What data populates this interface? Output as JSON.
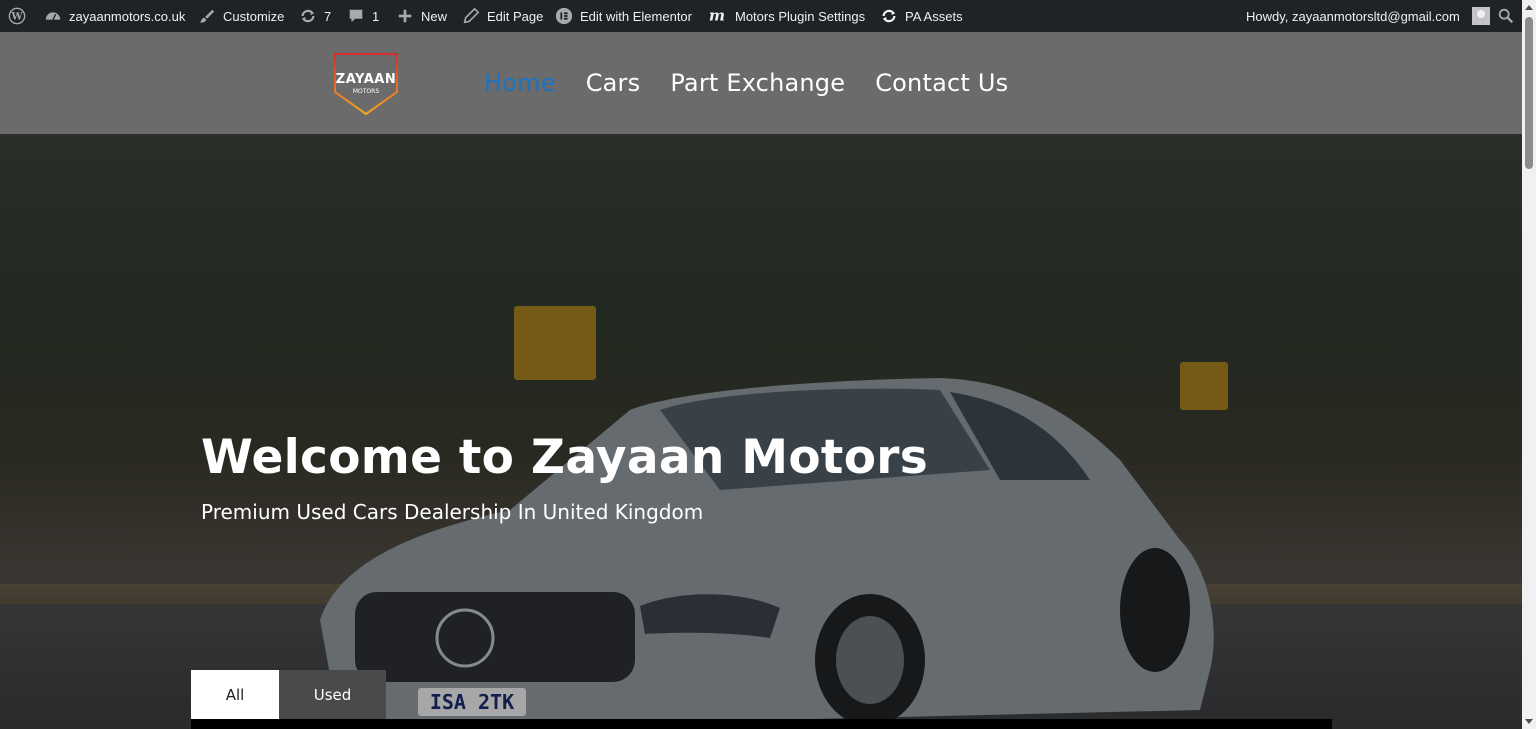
{
  "admin_bar": {
    "site_name": "zayaanmotors.co.uk",
    "customize": "Customize",
    "updates_count": "7",
    "comments_count": "1",
    "new": "New",
    "edit_page": "Edit Page",
    "edit_elementor": "Edit with Elementor",
    "motors_settings": "Motors Plugin Settings",
    "pa_assets": "PA Assets",
    "howdy": "Howdy, zayaanmotorsltd@gmail.com"
  },
  "header": {
    "logo_text": "ZAYAAN",
    "logo_subtext": "MOTORS",
    "nav": [
      {
        "label": "Home",
        "active": true
      },
      {
        "label": "Cars",
        "active": false
      },
      {
        "label": "Part Exchange",
        "active": false
      },
      {
        "label": "Contact Us",
        "active": false
      }
    ],
    "active_color": "#1e73be"
  },
  "hero": {
    "title": "Welcome to Zayaan Motors",
    "subtitle": "Premium Used Cars Dealership In United Kingdom",
    "tabs": [
      {
        "label": "All",
        "selected": true
      },
      {
        "label": "Used",
        "selected": false
      }
    ],
    "car_plate": "ISA 2TK"
  },
  "icons": [
    "wordpress-icon",
    "dashboard-icon",
    "brush-icon",
    "updates-icon",
    "comment-icon",
    "plus-icon",
    "pencil-icon",
    "elementor-icon",
    "motors-icon",
    "refresh-icon",
    "avatar",
    "search-icon"
  ]
}
